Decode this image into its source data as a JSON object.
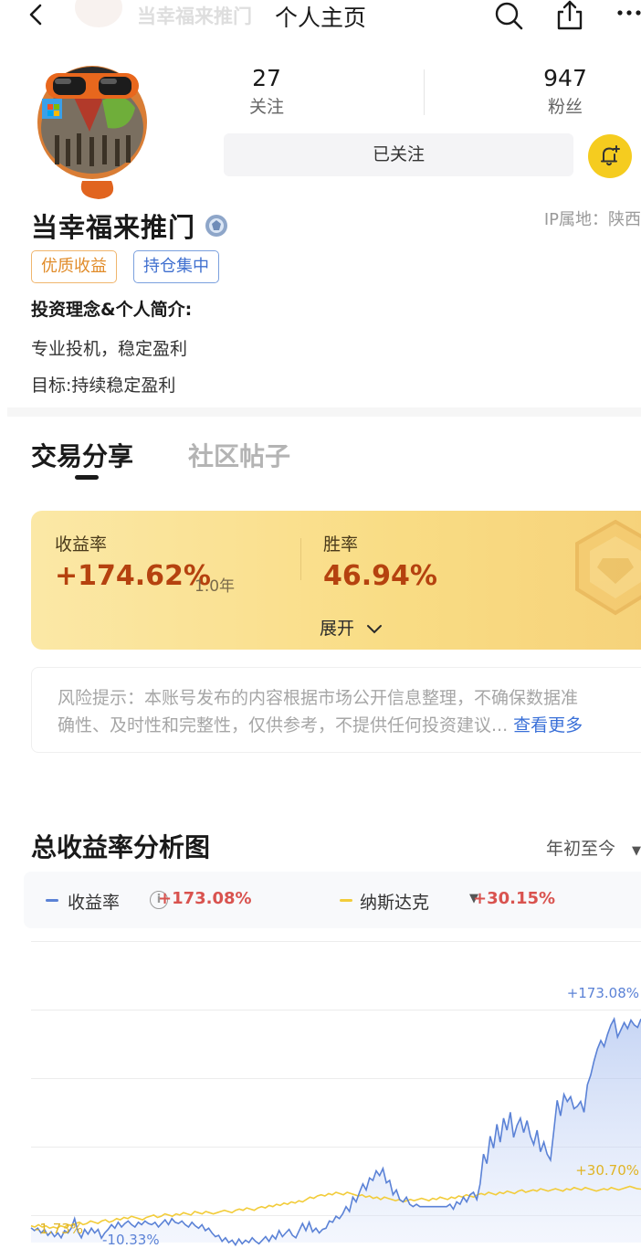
{
  "nav": {
    "ghost_name": "当幸福来推门",
    "title": "个人主页",
    "icons": [
      "back-arrow-icon",
      "search-icon",
      "share-icon",
      "more-icon"
    ]
  },
  "profile": {
    "following_count": "27",
    "following_label": "关注",
    "followers_count": "947",
    "followers_label": "粉丝",
    "follow_button_label": "已关注",
    "username": "当幸福来推门",
    "ip_location": "IP属地：陕西",
    "tags": [
      "优质收益",
      "持仓集中"
    ],
    "bio_title": "投资理念&个人简介:",
    "bio_lines": [
      "专业投机，稳定盈利",
      "目标:持续稳定盈利"
    ]
  },
  "tabs": {
    "active": "交易分享",
    "inactive": "社区帖子"
  },
  "performance": {
    "return_label": "收益率",
    "return_value": "+174.62%",
    "return_period": "1.0年",
    "winrate_label": "胜率",
    "winrate_value": "46.94%",
    "expand_label": "展开"
  },
  "risk": {
    "text": "风险提示：本账号发布的内容根据市场公开信息整理，不确保数据准确性、及时性和完整性，仅供参考，不提供任何投资建议...",
    "line1": "风险提示：本账号发布的内容根据市场公开信息整理，不确保数据准",
    "line2": "确性、及时性和完整性，仅供参考，不提供任何投资建议...",
    "more_link": "查看更多"
  },
  "chart_section": {
    "title": "总收益率分析图",
    "range_label": "年初至今",
    "legend_return_label": "收益率",
    "legend_return_value": "+173.08%",
    "legend_index_label": "纳斯达克",
    "legend_index_value": "+30.15%"
  },
  "colors": {
    "accent_blue": "#5b82d6",
    "index_yellow": "#f2cc3a",
    "positive_red": "#d9534f",
    "card_gold": "#f9dc84",
    "bell_yellow": "#f5cc1f"
  },
  "chart_data": {
    "type": "area",
    "series": [
      {
        "name": "收益率",
        "color": "#5b82d6",
        "start_label": "-1.73%",
        "min_label": "-10.33%",
        "end_label": "+173.08%",
        "values": [
          -1.7,
          -4,
          -2,
          -6,
          -3,
          -8,
          -5,
          -9,
          -6,
          -10,
          -4,
          -6,
          -2,
          6,
          -5,
          -10,
          -3,
          -7,
          -2,
          -6,
          -3,
          -10.33,
          -6,
          -3,
          1,
          -2,
          3,
          -1,
          2,
          4,
          1,
          -1,
          3,
          1,
          4,
          2,
          1,
          3,
          -1,
          2,
          5,
          1,
          6,
          3,
          2,
          4,
          1,
          -1,
          3,
          0,
          -2,
          1,
          -4,
          -2,
          -6,
          -9,
          -8,
          -13,
          -10,
          -14,
          -12,
          -16,
          -11,
          -15,
          -12,
          -14,
          -10,
          -13,
          -15,
          -12,
          -9,
          -13,
          -8,
          -11,
          -4,
          -9,
          -6,
          -3,
          -8,
          -10,
          -4,
          2,
          -4,
          3,
          -5,
          -2,
          -6,
          -3,
          -2,
          4,
          3,
          8,
          6,
          10,
          16,
          12,
          24,
          20,
          28,
          35,
          30,
          40,
          38,
          46,
          42,
          48,
          36,
          38,
          26,
          30,
          22,
          20,
          24,
          18,
          16,
          18,
          16,
          16,
          16,
          16,
          16,
          16,
          16,
          16,
          16,
          18,
          14,
          20,
          18,
          24,
          20,
          26,
          28,
          22,
          35,
          60,
          52,
          75,
          65,
          85,
          70,
          90,
          80,
          95,
          74,
          84,
          90,
          78,
          88,
          75,
          68,
          80,
          62,
          70,
          60,
          55,
          80,
          105,
          92,
          110,
          104,
          108,
          98,
          100,
          104,
          95,
          118,
          126,
          138,
          148,
          155,
          150,
          160,
          168,
          173.08,
          158,
          164,
          170,
          165,
          172,
          168,
          166,
          173.08
        ]
      },
      {
        "name": "纳斯达克",
        "color": "#f2cc3a",
        "end_label": "+30.70%",
        "values": [
          0,
          -1,
          1,
          -1,
          0,
          -2,
          -1,
          -2,
          0,
          -1,
          1,
          0,
          2,
          3,
          1,
          2,
          4,
          3,
          2,
          4,
          5,
          3,
          4,
          6,
          5,
          7,
          6,
          8,
          7,
          6,
          5,
          7,
          8,
          9,
          7,
          8,
          10,
          9,
          8,
          10,
          9,
          11,
          10,
          9,
          12,
          11,
          10,
          12,
          11,
          10,
          11,
          12,
          13,
          12,
          11,
          13,
          14,
          13,
          15,
          14,
          13,
          15,
          16,
          15,
          17,
          16,
          18,
          17,
          19,
          18,
          20,
          19,
          21,
          20,
          22,
          24,
          23,
          25,
          26,
          25,
          27,
          26,
          28,
          27,
          26,
          28,
          27,
          26,
          25,
          26,
          24,
          25,
          23,
          24,
          22,
          24,
          23,
          22,
          21,
          22,
          20,
          21,
          22,
          21,
          22,
          23,
          22,
          21,
          23,
          22,
          24,
          23,
          22,
          24,
          23,
          25,
          24,
          26,
          25,
          24,
          26,
          27,
          26,
          28,
          27,
          26,
          28,
          27,
          29,
          28,
          27,
          29,
          30,
          28,
          29,
          30,
          29,
          31,
          30,
          29,
          30,
          31,
          30,
          29,
          31,
          30,
          32,
          31,
          30,
          32,
          31,
          30,
          29,
          30,
          31,
          30,
          32,
          31,
          30,
          31,
          32,
          33,
          32,
          31,
          30.7
        ]
      }
    ],
    "grid": true,
    "ylim": [
      -14,
      200
    ]
  }
}
